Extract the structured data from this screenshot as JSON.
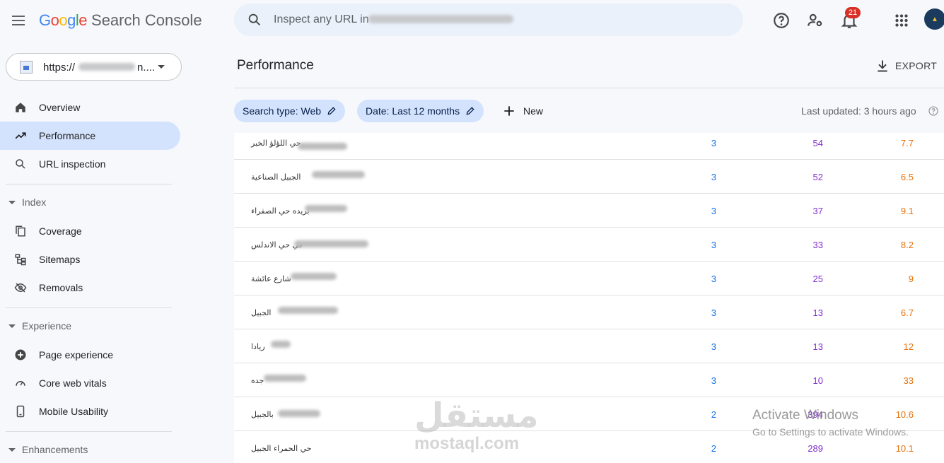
{
  "header": {
    "app_name_google": "Google",
    "app_name_product": "Search Console",
    "search_placeholder": "Inspect any URL in",
    "notification_count": "21",
    "icons": [
      "menu-icon",
      "search-icon",
      "help-icon",
      "manage-users-icon",
      "bell-icon",
      "apps-grid-icon"
    ]
  },
  "property": {
    "url": "https://",
    "suffix": "n...."
  },
  "sidebar": {
    "items": [
      {
        "label": "Overview",
        "icon": "home-icon"
      },
      {
        "label": "Performance",
        "icon": "trending-up-icon",
        "active": true
      },
      {
        "label": "URL inspection",
        "icon": "search-icon"
      }
    ],
    "index": {
      "title": "Index",
      "items": [
        {
          "label": "Coverage",
          "icon": "file-copy-icon"
        },
        {
          "label": "Sitemaps",
          "icon": "sitemap-icon"
        },
        {
          "label": "Removals",
          "icon": "eye-off-icon"
        }
      ]
    },
    "experience": {
      "title": "Experience",
      "items": [
        {
          "label": "Page experience",
          "icon": "plus-circle-icon"
        },
        {
          "label": "Core web vitals",
          "icon": "speed-gauge-icon"
        },
        {
          "label": "Mobile Usability",
          "icon": "smartphone-icon"
        }
      ]
    },
    "enhancements": {
      "title": "Enhancements"
    }
  },
  "main": {
    "title": "Performance",
    "export_label": "EXPORT",
    "filters": {
      "search_type": "Search type: Web",
      "date": "Date: Last 12 months",
      "new_label": "New"
    },
    "last_updated": "Last updated: 3 hours ago",
    "rows": [
      {
        "query": "حي اللؤلؤ الخبر",
        "clicks": "3",
        "impressions": "54",
        "position": "7.7"
      },
      {
        "query": "الجبيل الصناعية",
        "clicks": "3",
        "impressions": "52",
        "position": "6.5"
      },
      {
        "query": "بريده حي الصفراء",
        "clicks": "3",
        "impressions": "37",
        "position": "9.1"
      },
      {
        "query": "في حي الاندلس",
        "clicks": "3",
        "impressions": "33",
        "position": "8.2"
      },
      {
        "query": "شارع عائشة",
        "clicks": "3",
        "impressions": "25",
        "position": "9"
      },
      {
        "query": "الجبيل",
        "clicks": "3",
        "impressions": "13",
        "position": "6.7"
      },
      {
        "query": "ريادا",
        "clicks": "3",
        "impressions": "13",
        "position": "12"
      },
      {
        "query": "جده",
        "clicks": "3",
        "impressions": "10",
        "position": "33"
      },
      {
        "query": "بالجبيل",
        "clicks": "2",
        "impressions": "394",
        "position": "10.6"
      },
      {
        "query": "حي الحمراء الجبيل",
        "clicks": "2",
        "impressions": "289",
        "position": "10.1"
      }
    ]
  },
  "watermark": {
    "logo_text": "مستقل",
    "site": "mostaql.com",
    "activate_title": "Activate Windows",
    "activate_sub": "Go to Settings to activate Windows."
  },
  "colors": {
    "clicks": "#1a73e8",
    "impressions": "#8430ce",
    "position": "#e8710a",
    "active_nav": "#d3e3fd"
  }
}
